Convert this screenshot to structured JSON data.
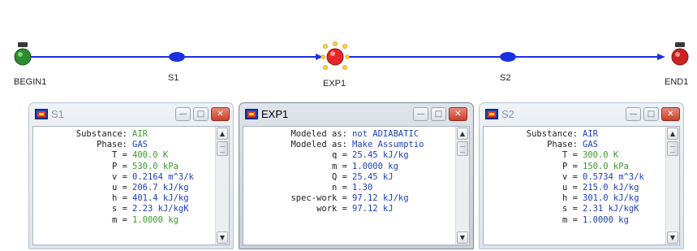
{
  "flow": {
    "nodes": {
      "begin": {
        "label": "BEGIN1"
      },
      "s1": {
        "label": "S1"
      },
      "exp1": {
        "label": "EXP1"
      },
      "s2": {
        "label": "S2"
      },
      "end": {
        "label": "END1"
      }
    },
    "line_color": "#1a2fe0",
    "begin_color": "#2e8b2e",
    "end_color": "#cc2222"
  },
  "windows": {
    "s1": {
      "title": "S1",
      "rows": [
        {
          "label": "Substance:",
          "value": "AIR",
          "color": "green"
        },
        {
          "label": "Phase:",
          "value": "GAS",
          "color": "blue"
        },
        {
          "label": "T =",
          "value": "400.0 K",
          "color": "green"
        },
        {
          "label": "P =",
          "value": "530.0 kPa",
          "color": "green"
        },
        {
          "label": "v =",
          "value": "0.2164 m^3/k",
          "color": "blue"
        },
        {
          "label": "u =",
          "value": "206.7 kJ/kg",
          "color": "blue"
        },
        {
          "label": "h =",
          "value": "401.4 kJ/kg",
          "color": "blue"
        },
        {
          "label": "s =",
          "value": "2.23 kJ/kgK",
          "color": "blue"
        },
        {
          "label": "m =",
          "value": "1.0000 kg",
          "color": "green"
        }
      ]
    },
    "exp1": {
      "title": "EXP1",
      "rows": [
        {
          "label": "Modeled as:",
          "value": "not ADIABATIC",
          "color": "blue"
        },
        {
          "label": "Modeled as:",
          "value": "Make Assumptio",
          "color": "blue"
        },
        {
          "label": "q =",
          "value": "25.45 kJ/kg",
          "color": "blue"
        },
        {
          "label": "m =",
          "value": "1.0000 kg",
          "color": "blue"
        },
        {
          "label": "Q =",
          "value": "25.45 kJ",
          "color": "blue"
        },
        {
          "label": "n =",
          "value": "1.30",
          "color": "blue"
        },
        {
          "label": "spec-work =",
          "value": "97.12 kJ/kg",
          "color": "blue"
        },
        {
          "label": "work =",
          "value": "97.12 kJ",
          "color": "blue"
        }
      ]
    },
    "s2": {
      "title": "S2",
      "rows": [
        {
          "label": "Substance:",
          "value": "AIR",
          "color": "blue"
        },
        {
          "label": "Phase:",
          "value": "GAS",
          "color": "blue"
        },
        {
          "label": "T =",
          "value": "300.0 K",
          "color": "green"
        },
        {
          "label": "P =",
          "value": "150.0 kPa",
          "color": "green"
        },
        {
          "label": "v =",
          "value": "0.5734 m^3/k",
          "color": "blue"
        },
        {
          "label": "u =",
          "value": "215.0 kJ/kg",
          "color": "blue"
        },
        {
          "label": "h =",
          "value": "301.0 kJ/kg",
          "color": "blue"
        },
        {
          "label": "s =",
          "value": "2.31 kJ/kgK",
          "color": "blue"
        },
        {
          "label": "m =",
          "value": "1.0000 kg",
          "color": "blue"
        }
      ]
    }
  }
}
